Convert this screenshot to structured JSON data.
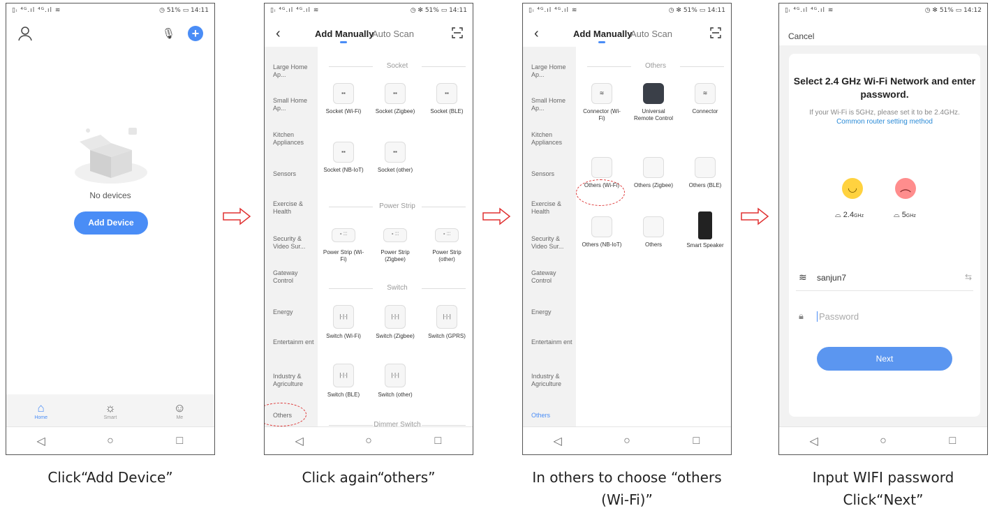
{
  "status": {
    "p1": {
      "left": "▯ᵢ ⁴ᴳ.ıl ⁴ᴳ.ıl ≋",
      "right": "◷ 51% ▭ 14:11"
    },
    "p2": {
      "left": "▯ᵢ ⁴ᴳ.ıl ⁴ᴳ.ıl ≋",
      "right": "◷ ✻ 51% ▭ 14:11"
    },
    "p3": {
      "left": "▯ᵢ ⁴ᴳ.ıl ⁴ᴳ.ıl ≋",
      "right": "◷ ✻ 51% ▭ 14:11"
    },
    "p4": {
      "left": "▯ᵢ ⁴ᴳ.ıl ⁴ᴳ.ıl ≋",
      "right": "◷ ✻ 51% ▭ 14:12"
    }
  },
  "screen1": {
    "empty_text": "No devices",
    "add_button": "Add Device",
    "tabs": [
      "Home",
      "Smart",
      "Me"
    ],
    "active_tab": "Home"
  },
  "header": {
    "tab_manual": "Add Manually",
    "tab_scan": "Auto Scan"
  },
  "sidebar": [
    "Large Home Ap...",
    "Small Home Ap...",
    "Kitchen Appliances",
    "Sensors",
    "Exercise & Health",
    "Security & Video Sur...",
    "Gateway Control",
    "Energy",
    "Entertainm ent",
    "Industry & Agriculture",
    "Others"
  ],
  "screen2": {
    "sections": [
      "Socket",
      "Power Strip",
      "Switch",
      "Dimmer Switch"
    ],
    "devices": [
      "Socket (Wi-Fi)",
      "Socket (Zigbee)",
      "Socket (BLE)",
      "Socket (NB-IoT)",
      "Socket (other)",
      "Power Strip (Wi-Fi)",
      "Power Strip (Zigbee)",
      "Power Strip (other)",
      "Switch (Wi-Fi)",
      "Switch (Zigbee)",
      "Switch (GPRS)",
      "Switch (BLE)",
      "Switch (other)"
    ]
  },
  "screen3": {
    "section": "Others",
    "devices": [
      "Connector (Wi-Fi)",
      "Universal Remote Control",
      "Connector",
      "Others (Wi-Fi)",
      "Others (Zigbee)",
      "Others (BLE)",
      "Others (NB-IoT)",
      "Others",
      "Smart Speaker"
    ]
  },
  "screen4": {
    "cancel": "Cancel",
    "title": "Select 2.4 GHz Wi-Fi Network and enter password.",
    "subtitle": "If your Wi-Fi is 5GHz, please set it to be 2.4GHz.",
    "link": "Common router setting method",
    "band_good": "2.4",
    "band_bad": "5",
    "band_unit": "GHz",
    "ssid": "sanjun7",
    "password_placeholder": "Password",
    "next": "Next"
  },
  "captions": [
    "Click“Add Device”",
    "Click again“others”",
    "In others to choose “others (Wi-Fi)”",
    "Input WIFI password Click“Next”"
  ],
  "colors": {
    "accent": "#4a8df6",
    "arrow": "#e03030",
    "circle": "#d33333"
  }
}
